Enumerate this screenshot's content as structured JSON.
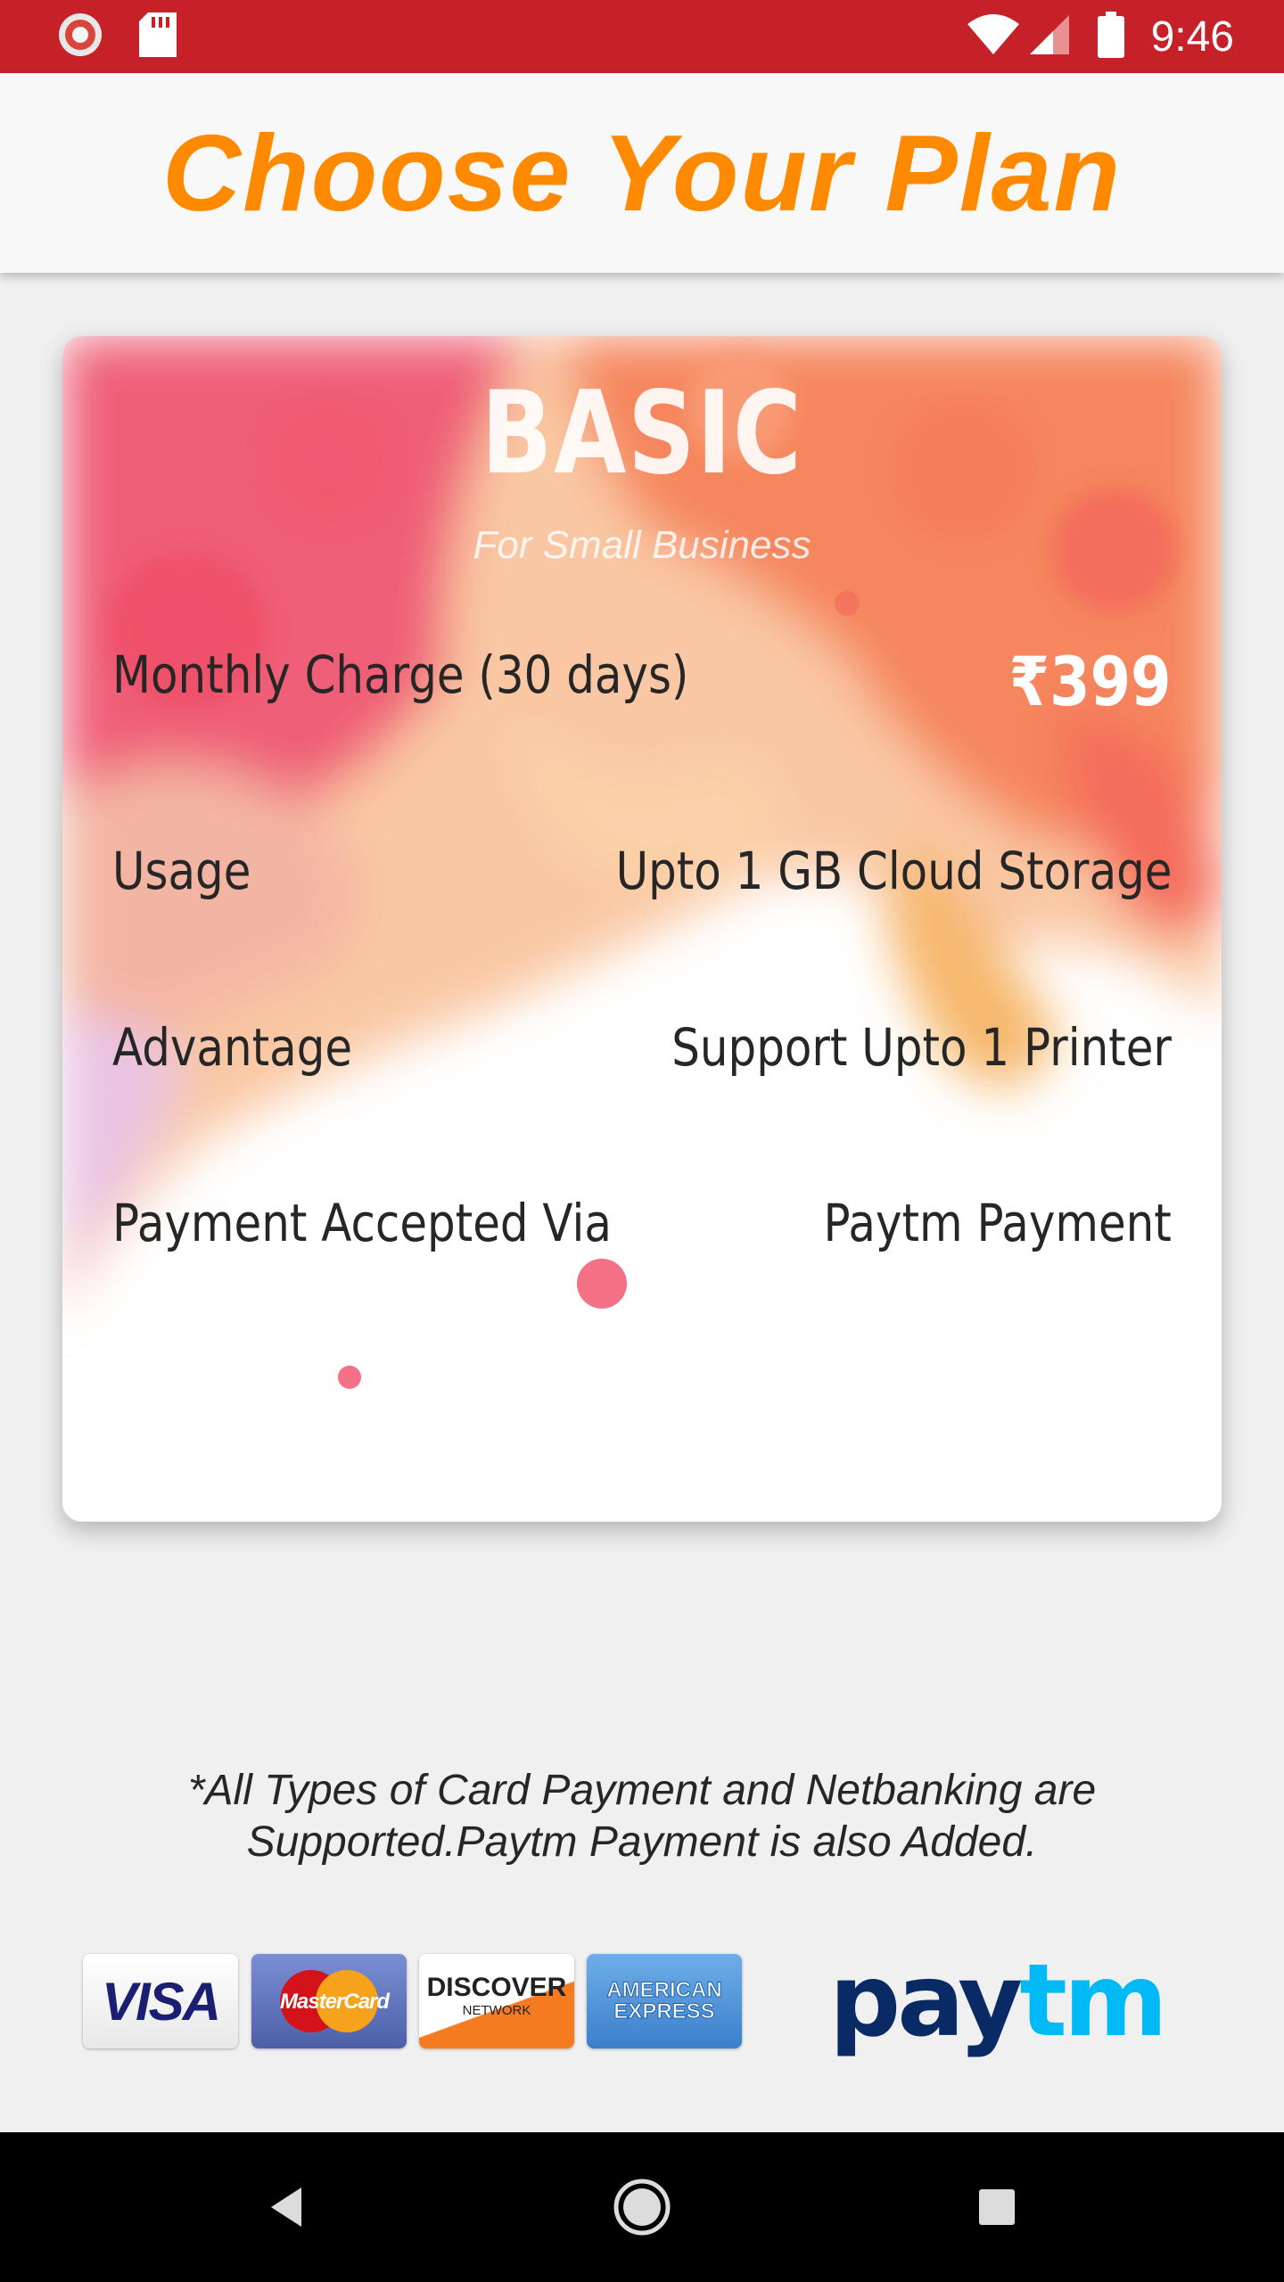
{
  "status_bar": {
    "time": "9:46",
    "icons": [
      "chrome-app-icon",
      "sd-card-icon",
      "wifi-icon",
      "signal-icon",
      "battery-icon"
    ]
  },
  "header": {
    "title": "Choose Your Plan",
    "title_color": "#ff8a00"
  },
  "plan": {
    "name": "BASIC",
    "subtitle": "For Small Business",
    "rows": [
      {
        "label": "Monthly Charge (30 days)",
        "value": "₹399"
      },
      {
        "label": "Usage",
        "value": "Upto 1 GB Cloud Storage"
      },
      {
        "label": "Advantage",
        "value": "Support Upto 1 Printer"
      },
      {
        "label": "Payment Accepted Via",
        "value": "Paytm Payment"
      }
    ]
  },
  "footnote": {
    "line1": "*All Types of Card Payment and Netbanking are",
    "line2": "Supported.Paytm Payment is also Added."
  },
  "payment_logos": {
    "visa": "VISA",
    "mastercard": "MasterCard",
    "discover": "DISCOVER",
    "discover_sub": "NETWORK",
    "amex_line1": "AMERICAN",
    "amex_line2": "EXPRESS",
    "paytm_pay": "pay",
    "paytm_tm": "tm"
  },
  "nav_bar": {
    "icons": [
      "back-icon",
      "home-icon",
      "recent-apps-icon"
    ]
  },
  "colors": {
    "status_bar": "#c62128",
    "accent": "#ff8a00",
    "background": "#f0f0f0"
  }
}
